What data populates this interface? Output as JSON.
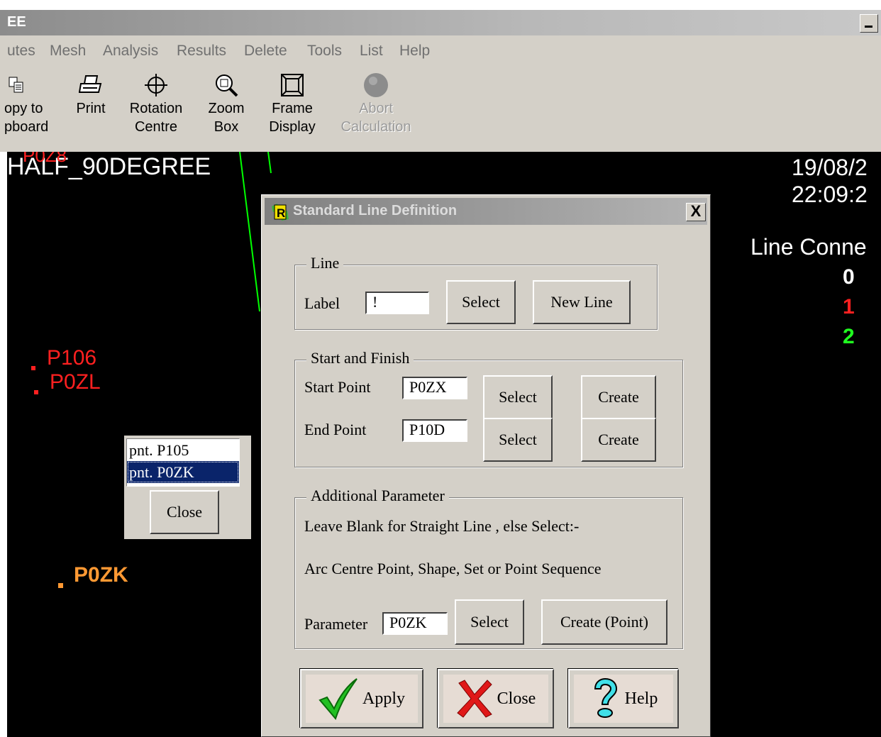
{
  "window": {
    "title": "EE"
  },
  "menu": [
    "utes",
    "Mesh",
    "Analysis",
    "Results",
    "Delete",
    "Tools",
    "List",
    "Help"
  ],
  "toolbar": [
    {
      "label": "opy to\npboard",
      "icon": "copy-icon",
      "enabled": true
    },
    {
      "label": "Print",
      "icon": "printer-icon",
      "enabled": true
    },
    {
      "label": "Rotation\nCentre",
      "icon": "crosshair-icon",
      "enabled": true
    },
    {
      "label": "Zoom\nBox",
      "icon": "magnifier-icon",
      "enabled": true
    },
    {
      "label": "Frame\nDisplay",
      "icon": "frame-icon",
      "enabled": true
    },
    {
      "label": "Abort\nCalculation",
      "icon": "stop-circle-icon",
      "enabled": false
    }
  ],
  "canvas": {
    "model_title": "HALF_90DEGREE",
    "overlap_label": "P0Z8",
    "date": "19/08/2",
    "time": "22:09:2",
    "legend_title": "Line Conne",
    "legend_items": [
      {
        "value": "0",
        "color": "#ffffff"
      },
      {
        "value": "1",
        "color": "#ff2020"
      },
      {
        "value": "2",
        "color": "#20ff20"
      }
    ],
    "point_labels": [
      "P106",
      "P0ZL",
      "P0ZK"
    ]
  },
  "popup": {
    "items": [
      "pnt. P105",
      "pnt. P0ZK"
    ],
    "selected_index": 1,
    "close_label": "Close"
  },
  "dialog": {
    "title": "Standard Line Definition",
    "close_glyph": "X",
    "line_group": {
      "legend": "Line",
      "label_text": "Label",
      "label_value": "!",
      "select_label": "Select",
      "new_line_label": "New Line"
    },
    "start_finish_group": {
      "legend": "Start and Finish",
      "start_label": "Start Point",
      "start_value": "P0ZX",
      "end_label": "End Point",
      "end_value": "P10D",
      "select_label": "Select",
      "create_label": "Create"
    },
    "additional_group": {
      "legend": "Additional Parameter",
      "hint1": "Leave Blank for Straight Line , else Select:-",
      "hint2": "Arc Centre Point,  Shape, Set or Point Sequence",
      "param_label": "Parameter",
      "param_value": "P0ZK",
      "select_label": "Select",
      "create_point_label": "Create (Point)"
    },
    "buttons": {
      "apply": "Apply",
      "close": "Close",
      "help": "Help"
    }
  },
  "colors": {
    "canvas_bg": "#000000",
    "point_red": "#ff2020",
    "highlight_orange": "#ff9933",
    "selection_blue": "#0a246a",
    "face": "#d4d0c8"
  }
}
